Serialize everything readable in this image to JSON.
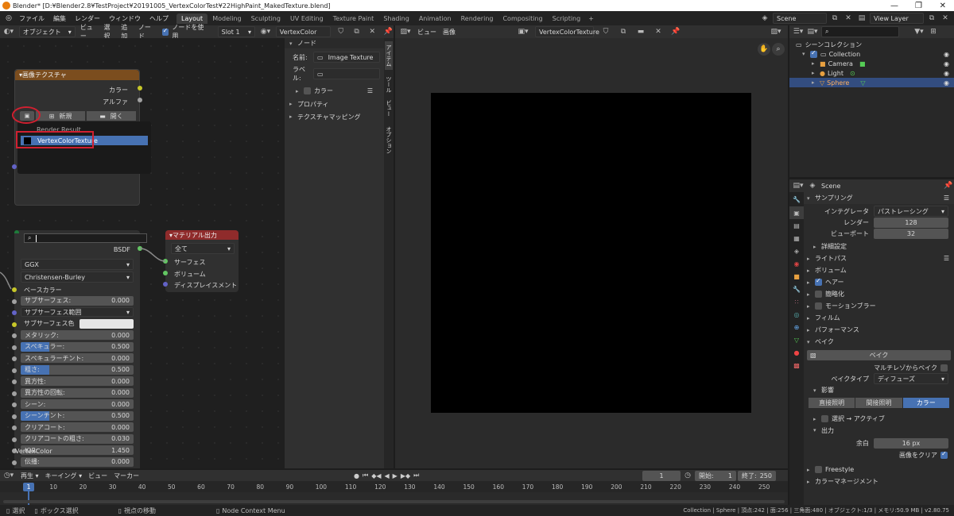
{
  "titlebar": {
    "title": "Blender* [D:¥Blender2.8¥TestProject¥20191005_VertexColorTest¥22HighPaint_MakedTexture.blend]"
  },
  "menu": [
    "ファイル",
    "編集",
    "レンダー",
    "ウィンドウ",
    "ヘルプ"
  ],
  "workspaces": [
    "Layout",
    "Modeling",
    "Sculpting",
    "UV Editing",
    "Texture Paint",
    "Shading",
    "Animation",
    "Rendering",
    "Compositing",
    "Scripting"
  ],
  "active_workspace": "Layout",
  "scene": "Scene",
  "view_layer": "View Layer",
  "node_header": {
    "mode": "オブジェクト",
    "menus": [
      "ビュー",
      "選択",
      "追加",
      "ノード"
    ],
    "use_nodes": "ノードを使用",
    "slot": "Slot 1",
    "material": "VertexColor"
  },
  "image_header": {
    "menus": [
      "ビュー",
      "画像"
    ],
    "image": "VertexColorTexture"
  },
  "image_tex_node": {
    "title": "画像テクスチャ",
    "out_color": "カラー",
    "out_alpha": "アルファ",
    "new_btn": "新規",
    "open_btn": "開く"
  },
  "image_dropdown": {
    "items": [
      "Render Result",
      "VertexColorTexture"
    ]
  },
  "bsdf_node": {
    "out": "BSDF",
    "distribution": "GGX",
    "subsurface_method": "Christensen-Burley",
    "params": [
      {
        "label": "ベースカラー",
        "value": "",
        "kind": "label"
      },
      {
        "label": "サブサーフェス:",
        "value": "0.000",
        "fill": 0
      },
      {
        "label": "サブサーフェス範囲",
        "value": "",
        "kind": "dd"
      },
      {
        "label": "サブサーフェス色",
        "value": "",
        "kind": "color"
      },
      {
        "label": "メタリック:",
        "value": "0.000",
        "fill": 0
      },
      {
        "label": "スペキュラー:",
        "value": "0.500",
        "fill": 0.5
      },
      {
        "label": "スペキュラーチント:",
        "value": "0.000",
        "fill": 0
      },
      {
        "label": "粗さ:",
        "value": "0.500",
        "fill": 0.5
      },
      {
        "label": "異方性:",
        "value": "0.000",
        "fill": 0
      },
      {
        "label": "異方性の回転:",
        "value": "0.000",
        "fill": 0
      },
      {
        "label": "シーン:",
        "value": "0.000",
        "fill": 0
      },
      {
        "label": "シーンチント:",
        "value": "0.500",
        "fill": 0.5
      },
      {
        "label": "クリアコート:",
        "value": "0.000",
        "fill": 0
      },
      {
        "label": "クリアコートの粗さ:",
        "value": "0.030",
        "fill": 0
      },
      {
        "label": "IOR:",
        "value": "1.450",
        "fill": 0
      },
      {
        "label": "伝播:",
        "value": "0.000",
        "fill": 0
      }
    ],
    "footer_label": "VertexColor"
  },
  "mat_output": {
    "title": "マテリアル出力",
    "target": "全て",
    "inputs": [
      "サーフェス",
      "ボリューム",
      "ディスプレイスメント"
    ]
  },
  "sidebar": {
    "section": "ノード",
    "name_label": "名前:",
    "name_value": "Image Texture",
    "label_label": "ラベル:",
    "color": "カラー",
    "props": "プロパティ",
    "mapping": "テクスチャマッピング",
    "tabs": [
      "アイテム",
      "ツール",
      "ビュー",
      "オプション"
    ]
  },
  "outliner": {
    "root": "シーンコレクション",
    "items": [
      "Collection",
      "Camera",
      "Light",
      "Sphere"
    ]
  },
  "props": {
    "scene": "Scene",
    "sampling": "サンプリング",
    "integrator_label": "インテグレータ",
    "integrator": "パストレーシング",
    "render_label": "レンダー",
    "render_value": "128",
    "viewport_label": "ビューポート",
    "viewport_value": "32",
    "sections": [
      "詳細設定",
      "ライトパス",
      "ボリューム",
      "ヘアー",
      "簡略化",
      "モーションブラー",
      "フィルム",
      "パフォーマンス",
      "ベイク"
    ],
    "bake_btn": "ベイク",
    "multires": "マルチレゾからベイク",
    "bake_type_label": "ベイクタイプ",
    "bake_type": "ディフューズ",
    "influence": "影響",
    "seg": [
      "直接照明",
      "間接照明",
      "カラー"
    ],
    "sel_active": "選択 → アクティブ",
    "output": "出力",
    "margin_label": "余白",
    "margin_value": "16 px",
    "clear_img": "画像をクリア",
    "freestyle": "Freestyle",
    "color_mgmt": "カラーマネージメント"
  },
  "timeline": {
    "menus": [
      "再生",
      "キーイング",
      "ビュー",
      "マーカー"
    ],
    "current": "1",
    "start_label": "開始:",
    "start": "1",
    "end_label": "終了:",
    "end": "250",
    "ticks": [
      "1",
      "10",
      "20",
      "30",
      "40",
      "50",
      "60",
      "70",
      "80",
      "90",
      "100",
      "110",
      "120",
      "130",
      "140",
      "150",
      "160",
      "170",
      "180",
      "190",
      "200",
      "210",
      "220",
      "230",
      "240",
      "250"
    ]
  },
  "statusbar": {
    "select": "選択",
    "box": "ボックス選択",
    "move": "視点の移動",
    "ctx": "Node Context Menu",
    "stats": "Collection | Sphere | 頂点:242 | 面:256 | 三角面:480 | オブジェクト:1/3 | メモリ:50.9 MB | v2.80.75"
  }
}
